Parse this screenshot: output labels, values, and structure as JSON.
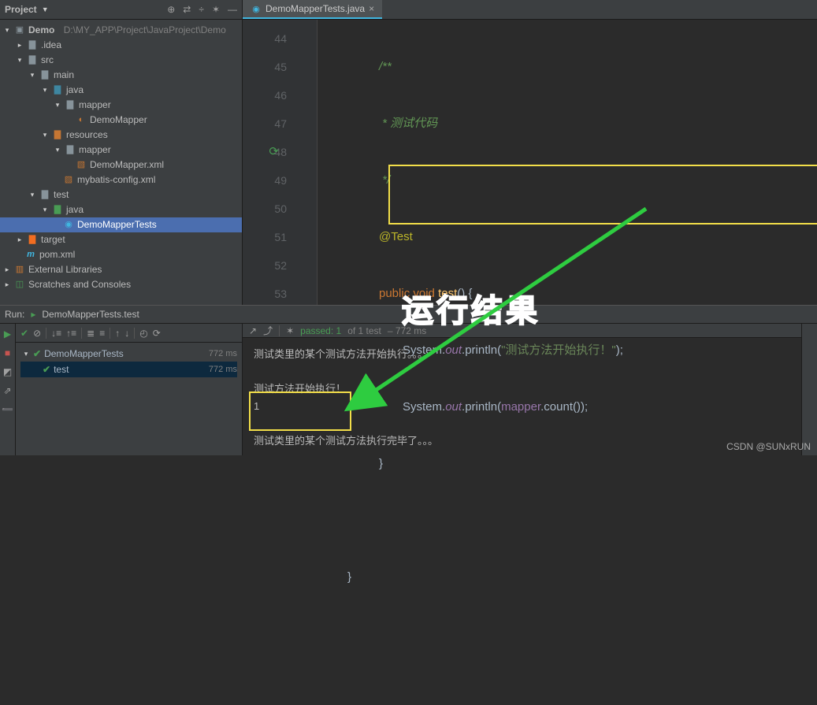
{
  "header": {
    "project_label": "Project"
  },
  "editor_tab": {
    "filename": "DemoMapperTests.java",
    "close": "×"
  },
  "tree": {
    "root": "Demo",
    "root_path": "D:\\MY_APP\\Project\\JavaProject\\Demo",
    "idea": ".idea",
    "src": "src",
    "main": "main",
    "java": "java",
    "mapper": "mapper",
    "demo_mapper": "DemoMapper",
    "resources": "resources",
    "mapper2": "mapper",
    "demo_mapper_xml": "DemoMapper.xml",
    "mybatis_xml": "mybatis-config.xml",
    "test": "test",
    "java2": "java",
    "demo_tests": "DemoMapperTests",
    "target": "target",
    "pom": "pom.xml",
    "ext_lib": "External Libraries",
    "scratches": "Scratches and Consoles"
  },
  "editor": {
    "lines": [
      "44",
      "45",
      "46",
      "47",
      "48",
      "49",
      "50",
      "51",
      "52",
      "53"
    ],
    "doc_start": "/**",
    "doc_mid": " * 测试代码",
    "doc_end": " */",
    "ann": "@Test",
    "sig_public": "public",
    "sig_void": "void",
    "sig_name": "test",
    "sig_open": "() {",
    "l49_a": "System.",
    "l49_out": "out",
    "l49_b": ".println(",
    "l49_str": "\"测试方法开始执行！\"",
    "l49_c": ");",
    "l50_a": "System.",
    "l50_out": "out",
    "l50_b": ".println(",
    "l50_mapper": "mapper",
    "l50_c": ".count());",
    "brace_close": "}",
    "outer_close": "}"
  },
  "run": {
    "label": "Run:",
    "title": "DemoMapperTests.test",
    "summary_a": "passed: 1",
    "summary_b": "of 1 test",
    "summary_c": "– 772 ms",
    "tree_root": "DemoMapperTests",
    "tree_leaf": "test",
    "time1": "772 ms",
    "time2": "772 ms",
    "console_line1": "测试类里的某个测试方法开始执行。。。",
    "console_line3": "测试方法开始执行！",
    "console_line4": "1",
    "console_line6": "测试类里的某个测试方法执行完毕了。。。"
  },
  "annotation": {
    "label": "运行结果"
  },
  "watermark": "CSDN @SUNxRUN"
}
